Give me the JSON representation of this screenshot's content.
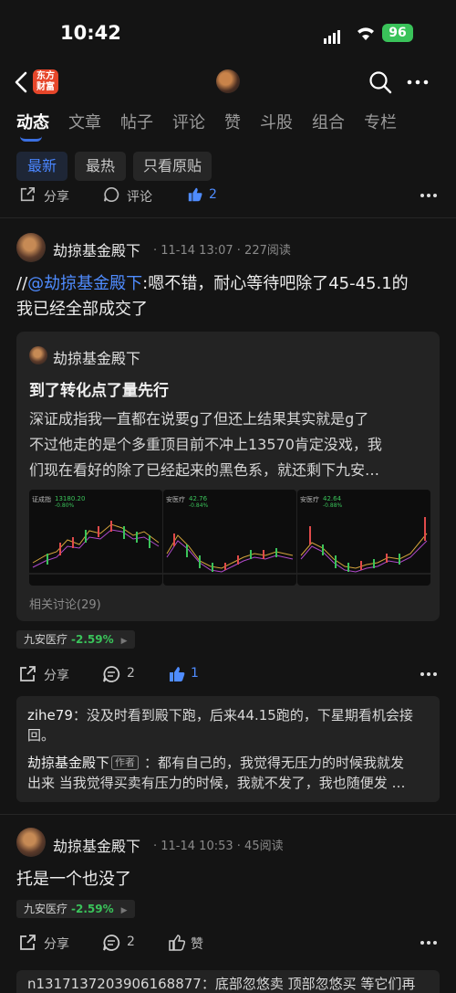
{
  "status_bar": {
    "time": "10:42",
    "battery": "96"
  },
  "header": {
    "logo_line1": "东方",
    "logo_line2": "财富"
  },
  "tabs": [
    "动态",
    "文章",
    "帖子",
    "评论",
    "赞",
    "斗股",
    "组合",
    "专栏"
  ],
  "filters": [
    "最新",
    "最热",
    "只看原贴"
  ],
  "top_actions": {
    "share": "分享",
    "comment": "评论",
    "likes": "2"
  },
  "post1": {
    "author": "劫掠基金殿下",
    "date": "11-14 13:07",
    "reads": "227阅读",
    "text_prefix": "//",
    "mention": "@劫掠基金殿下",
    "text_line1": ":嗯不错，耐心等待吧除了45-45.1的",
    "text_line2": "我已经全部成交了",
    "quote": {
      "author": "劫掠基金殿下",
      "title": "到了转化点了量先行",
      "line1": "深证成指我一直都在说要g了但还上结果其实就是g了",
      "line2": "不过他走的是个多重顶目前不冲上13570肯定没戏，我",
      "line3": "们现在看好的除了已经起来的黑色系，就还剩下九安…",
      "thumbs": [
        {
          "label": "证成指",
          "value": "13180.20",
          "change": "-0.80%"
        },
        {
          "label": "安医疗",
          "value": "42.76",
          "change": "-0.84%"
        },
        {
          "label": "安医疗",
          "value": "42.64",
          "change": "-0.88%"
        }
      ],
      "related": "相关讨论(29)"
    },
    "stock": {
      "name": "九安医疗",
      "change": "-2.59%"
    },
    "share": "分享",
    "comments": "2",
    "likes": "1",
    "comment1_user": "zihe79",
    "comment1_line1": "：没及时看到殿下跑，后来44.15跑的，下星期看机会接",
    "comment1_line2": "回。",
    "comment2_user": "劫掠基金殿下",
    "comment2_tag": "作者",
    "comment2_line1": "：都有自己的，我觉得无压力的时候我就发",
    "comment2_line2": "出来 当我觉得买卖有压力的时候，我就不发了，我也随便发 …"
  },
  "post2": {
    "author": "劫掠基金殿下",
    "date": "11-14 10:53",
    "reads": "45阅读",
    "text": "托是一个也没了",
    "stock": {
      "name": "九安医疗",
      "change": "-2.59%"
    },
    "share": "分享",
    "comments": "2",
    "like_label": "赞",
    "next_comment": "n13171372039061​68877：底部忽悠卖 顶部忽悠买 等它们再"
  }
}
